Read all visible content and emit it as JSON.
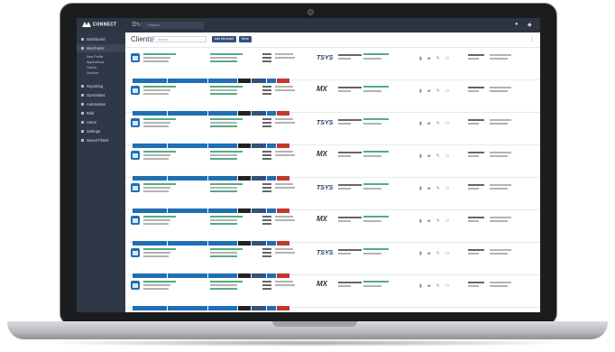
{
  "app": {
    "logo": "CONNECT",
    "search_placeholder": "Search"
  },
  "sidebar": {
    "items": [
      {
        "label": "Dashboard"
      },
      {
        "label": "Merchants"
      },
      {
        "label": "Reporting"
      },
      {
        "label": "Operations"
      },
      {
        "label": "Automation"
      },
      {
        "label": "Risk"
      },
      {
        "label": "Users"
      },
      {
        "label": "Settings"
      },
      {
        "label": "Saved Filters"
      }
    ],
    "subitems": [
      "New Profile",
      "Applications",
      "Clients",
      "Vendors"
    ]
  },
  "header": {
    "title": "Clients",
    "search_placeholder": "Search",
    "filter_toggle": "Filter",
    "btn_export": "Add Merchant",
    "btn_more": "More"
  },
  "cards": [
    {
      "processor": "TSYS",
      "kind": "tsys"
    },
    {
      "processor": "MX",
      "kind": "mx"
    },
    {
      "processor": "TSYS",
      "kind": "tsys"
    },
    {
      "processor": "MX",
      "kind": "mx"
    },
    {
      "processor": "TSYS",
      "kind": "tsys"
    },
    {
      "processor": "MX",
      "kind": "mx"
    },
    {
      "processor": "TSYS",
      "kind": "tsys"
    },
    {
      "processor": "MX",
      "kind": "mx"
    }
  ],
  "colors": {
    "sidebar": "#2f3847",
    "topbar": "#2d3543",
    "accent": "#33527a",
    "link": "#1e8e5e",
    "tag_blue": "#1f6fb5",
    "tag_red": "#c0392b",
    "tag_dark": "#222"
  }
}
